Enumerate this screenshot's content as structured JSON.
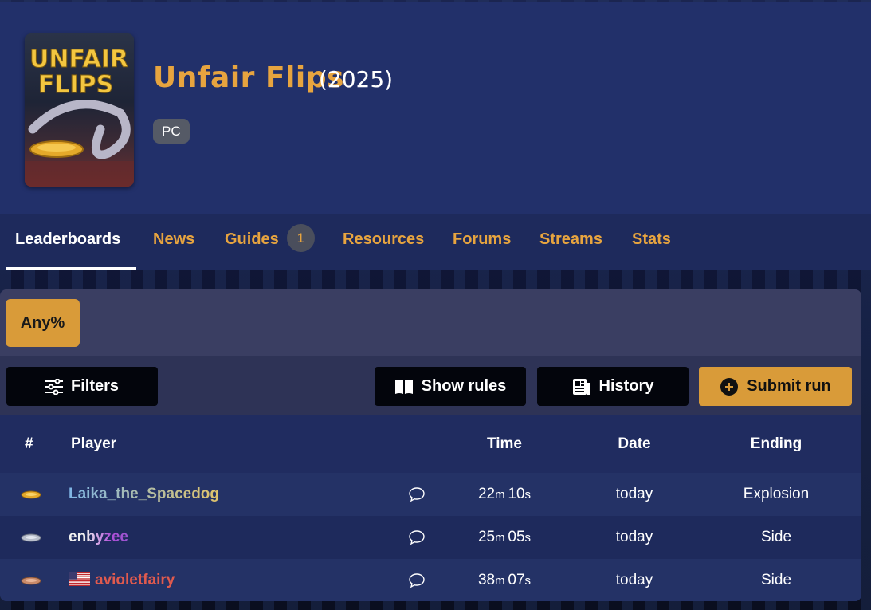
{
  "game": {
    "title": "Unfair Flips",
    "year": "(2025)",
    "platform": "PC",
    "cover_logo_text": "UNFAIR FLIPS"
  },
  "tabs": [
    {
      "label": "Leaderboards",
      "active": true
    },
    {
      "label": "News"
    },
    {
      "label": "Guides",
      "badge": "1"
    },
    {
      "label": "Resources"
    },
    {
      "label": "Forums"
    },
    {
      "label": "Streams"
    },
    {
      "label": "Stats"
    }
  ],
  "category": {
    "label": "Any%"
  },
  "toolbar": {
    "filters_label": "Filters",
    "show_rules_label": "Show rules",
    "history_label": "History",
    "submit_label": "Submit run"
  },
  "table": {
    "headers": {
      "rank": "#",
      "player": "Player",
      "time": "Time",
      "date": "Date",
      "ending": "Ending"
    },
    "rows": [
      {
        "medal": "gold",
        "player": "Laika_the_Spacedog",
        "flag": "",
        "time_m": "22",
        "time_m_unit": "m",
        "time_s": "10",
        "time_s_unit": "s",
        "date": "today",
        "ending": "Explosion"
      },
      {
        "medal": "silver",
        "player": "enbyzee",
        "flag": "",
        "time_m": "25",
        "time_m_unit": "m",
        "time_s": "05",
        "time_s_unit": "s",
        "date": "today",
        "ending": "Side"
      },
      {
        "medal": "bronze",
        "player": "avioletfairy",
        "flag": "us",
        "time_m": "38",
        "time_m_unit": "m",
        "time_s": "07",
        "time_s_unit": "s",
        "date": "today",
        "ending": "Side"
      }
    ]
  },
  "colors": {
    "accent": "#e7a43f",
    "header_bg": "#22306a",
    "player1": "#8fb8d8",
    "player2": "#a36fd6",
    "player3": "#e05a4e"
  }
}
